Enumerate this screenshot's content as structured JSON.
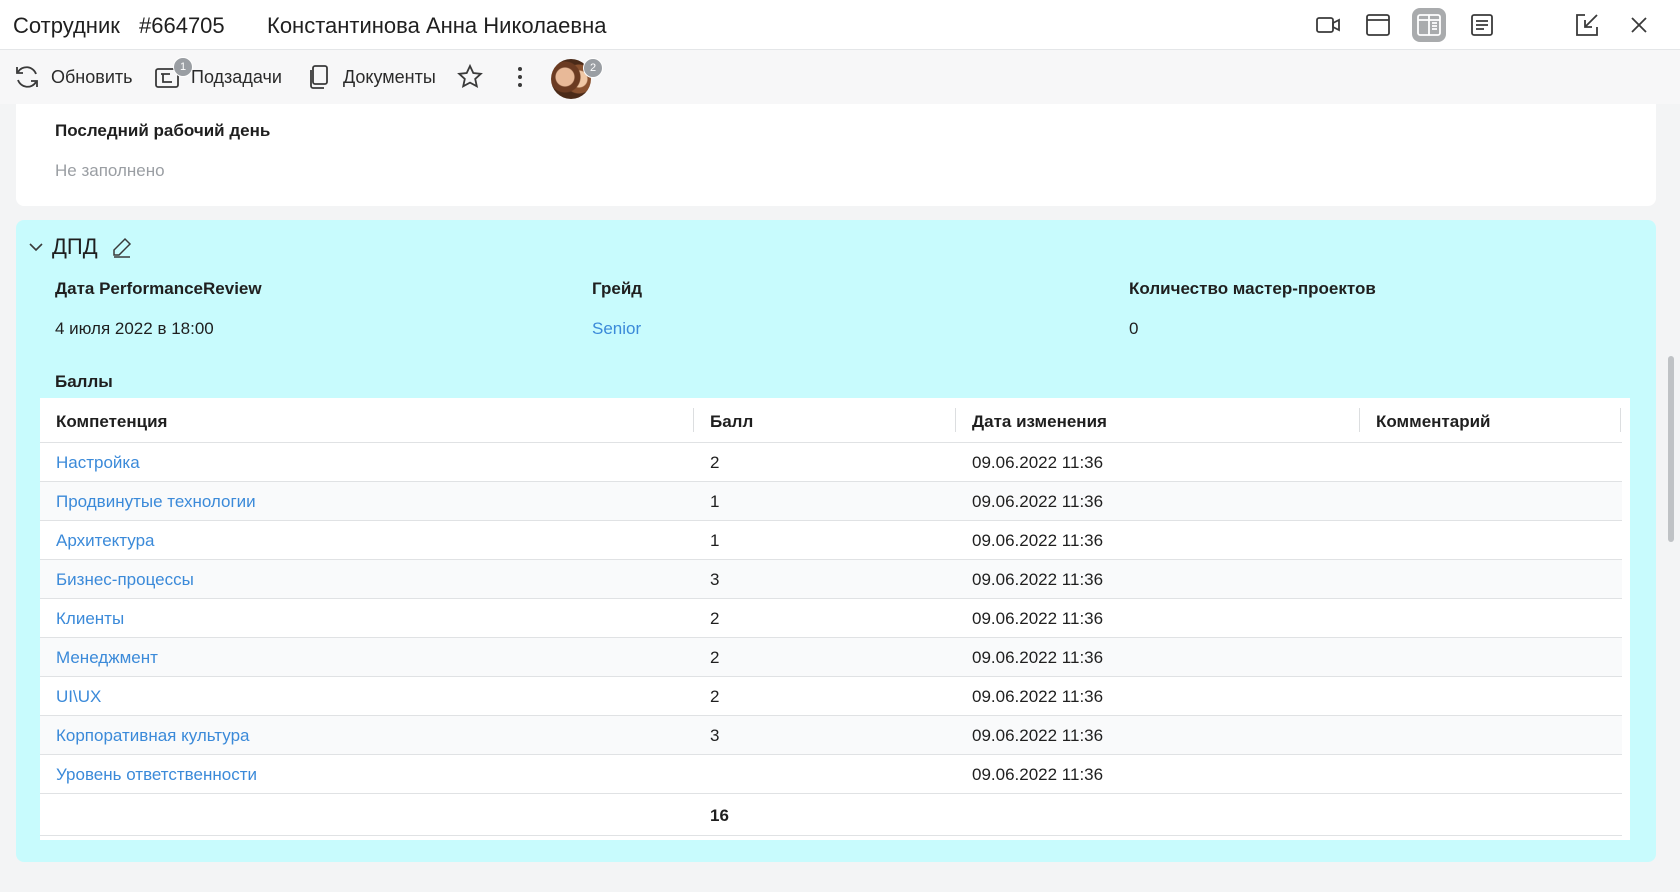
{
  "header": {
    "entity_type": "Сотрудник",
    "entity_id": "#664705",
    "entity_name": "Константинова Анна Николаевна",
    "icons": [
      "video-icon",
      "window-icon",
      "split-view-icon",
      "document-view-icon",
      "minimize-icon",
      "close-icon"
    ]
  },
  "toolbar": {
    "refresh_label": "Обновить",
    "subtasks_label": "Подзадачи",
    "subtasks_count": "1",
    "documents_label": "Документы",
    "participants_count": "2"
  },
  "last_day": {
    "label": "Последний рабочий день",
    "value": "Не заполнено"
  },
  "dpd": {
    "title": "ДПД",
    "review_label": "Дата PerformanceReview",
    "review_value": "4 июля 2022 в 18:00",
    "grade_label": "Грейд",
    "grade_value": "Senior",
    "master_label": "Количество мастер-проектов",
    "master_value": "0",
    "scores_label": "Баллы",
    "columns": [
      "Компетенция",
      "Балл",
      "Дата изменения",
      "Комментарий"
    ],
    "rows": [
      {
        "competency": "Настройка",
        "score": "2",
        "date": "09.06.2022 11:36",
        "comment": ""
      },
      {
        "competency": "Продвинутые технологии",
        "score": "1",
        "date": "09.06.2022 11:36",
        "comment": ""
      },
      {
        "competency": "Архитектура",
        "score": "1",
        "date": "09.06.2022 11:36",
        "comment": ""
      },
      {
        "competency": "Бизнес-процессы",
        "score": "3",
        "date": "09.06.2022 11:36",
        "comment": ""
      },
      {
        "competency": "Клиенты",
        "score": "2",
        "date": "09.06.2022 11:36",
        "comment": ""
      },
      {
        "competency": "Менеджмент",
        "score": "2",
        "date": "09.06.2022 11:36",
        "comment": ""
      },
      {
        "competency": "UI\\UX",
        "score": "2",
        "date": "09.06.2022 11:36",
        "comment": ""
      },
      {
        "competency": "Корпоративная культура",
        "score": "3",
        "date": "09.06.2022 11:36",
        "comment": ""
      },
      {
        "competency": "Уровень ответственности",
        "score": "",
        "date": "09.06.2022 11:36",
        "comment": ""
      }
    ],
    "total": "16"
  },
  "colors": {
    "section_bg": "#c8fbfd",
    "link": "#3b8ad9",
    "active_view": "#a9abad"
  }
}
